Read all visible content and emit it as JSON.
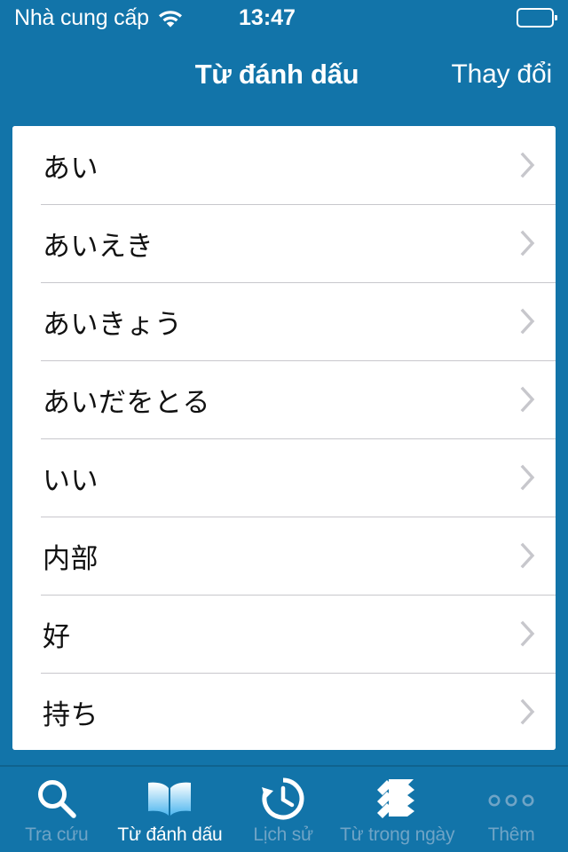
{
  "theme": {
    "brand_blue": "#1274a9",
    "tabbar_divider": "#0f638f",
    "card_white": "#ffffff",
    "separator": "#c8c7cc",
    "chevron_gray": "#c7c7cc",
    "row_text": "#111111",
    "tab_inactive": "#6fa4c6",
    "tab_active": "#ffffff",
    "book_icon_gradient_top": "#ffffff",
    "book_icon_gradient_bottom": "#4db6ef"
  },
  "status_bar": {
    "carrier": "Nhà cung cấp",
    "wifi_icon": "wifi-icon",
    "time": "13:47",
    "battery_icon": "battery-icon"
  },
  "nav_bar": {
    "title": "Từ đánh dấu",
    "action_label": "Thay đổi"
  },
  "list": {
    "chevron_icon": "chevron-right-icon",
    "items": [
      {
        "label": "あい"
      },
      {
        "label": "あいえき"
      },
      {
        "label": "あいきょう"
      },
      {
        "label": "あいだをとる"
      },
      {
        "label": "いい"
      },
      {
        "label": "内部"
      },
      {
        "label": "好"
      },
      {
        "label": "持ち"
      }
    ]
  },
  "tab_bar": {
    "active_index": 1,
    "items": [
      {
        "label": "Tra cứu",
        "icon": "search-icon"
      },
      {
        "label": "Từ đánh dấu",
        "icon": "open-book-icon"
      },
      {
        "label": "Lịch sử",
        "icon": "history-clock-icon"
      },
      {
        "label": "Từ trong ngày",
        "icon": "stacked-pages-icon"
      },
      {
        "label": "Thêm",
        "icon": "ellipsis-icon"
      }
    ]
  }
}
